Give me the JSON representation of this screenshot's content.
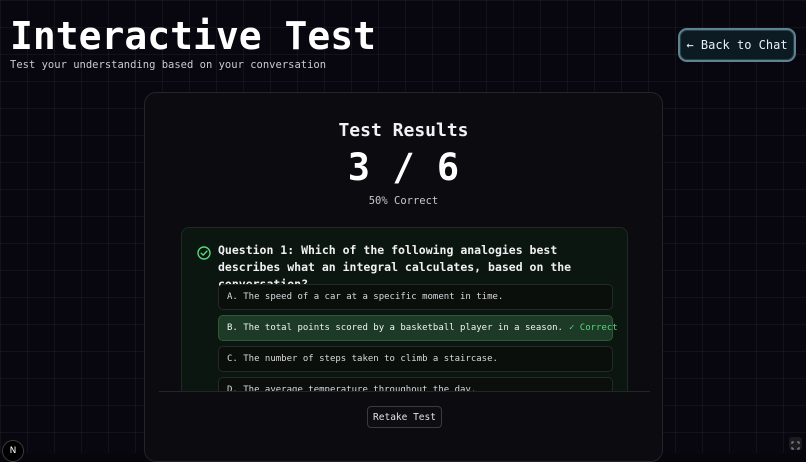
{
  "header": {
    "title": "Interactive Test",
    "subtitle": "Test your understanding based on your conversation",
    "back_label": "← Back to Chat"
  },
  "results": {
    "title": "Test Results",
    "score": "3 / 6",
    "percent_label": "50% Correct"
  },
  "question": {
    "text": "Question 1: Which of the following analogies best describes what an integral calculates, based on the conversation?",
    "options": [
      {
        "label": "A. The speed of a car at a specific moment in time."
      },
      {
        "label": "B. The total points scored by a basketball player in a season.",
        "tag": "✓ Correct"
      },
      {
        "label": "C. The number of steps taken to climb a staircase."
      },
      {
        "label": "D. The average temperature throughout the day."
      }
    ]
  },
  "footer": {
    "retake_label": "Retake Test"
  },
  "misc": {
    "badge_label": "N"
  },
  "colors": {
    "correct_green": "#57d87a",
    "correct_bg": "#1d3a26",
    "back_border": "#5d8290"
  }
}
